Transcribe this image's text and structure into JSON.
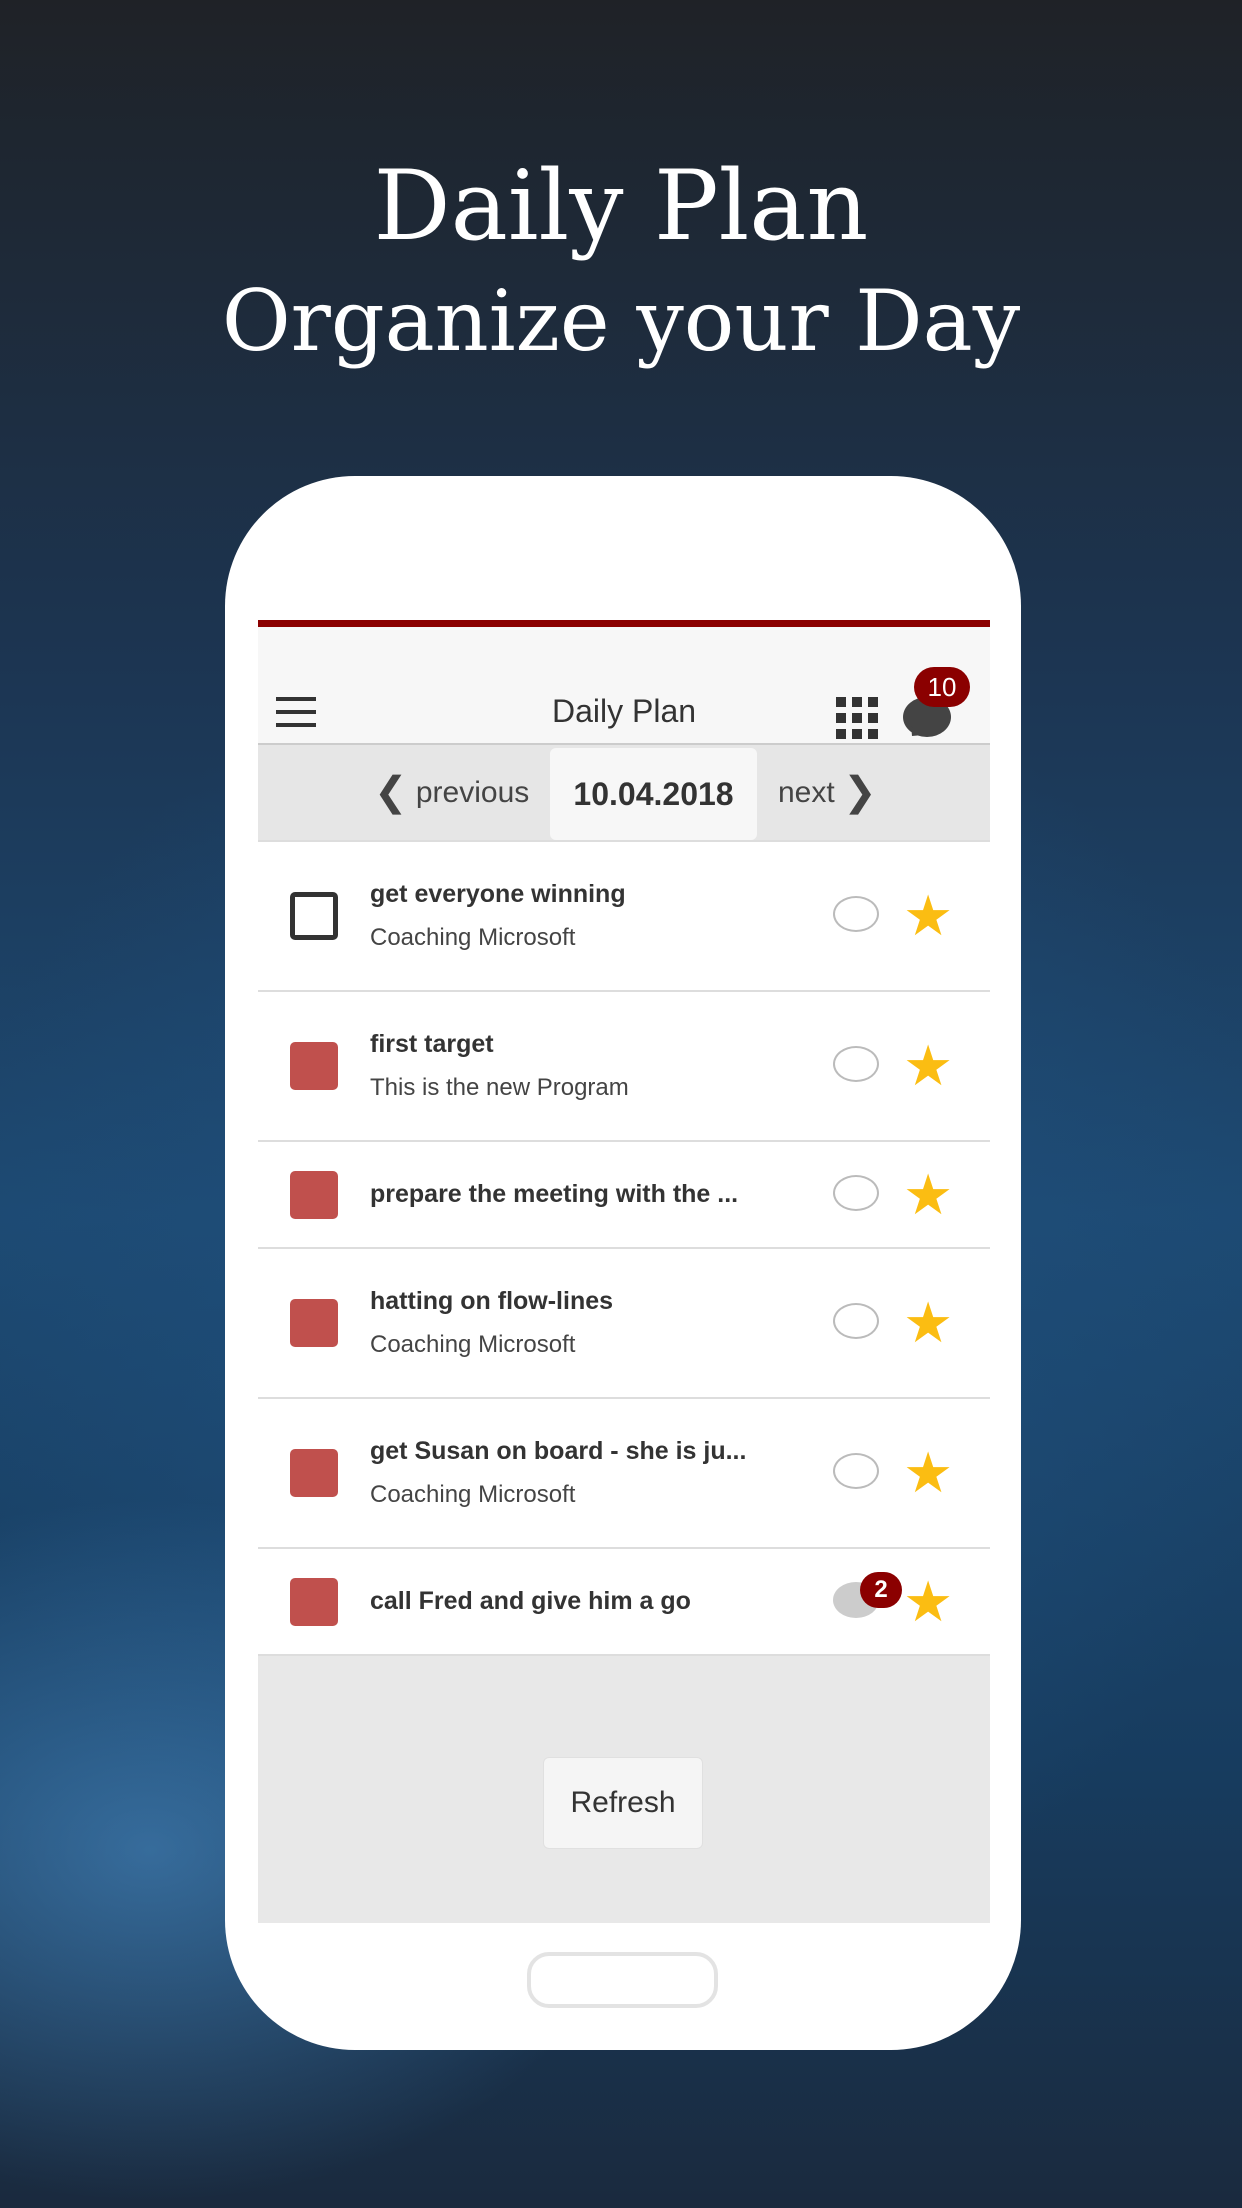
{
  "hero": {
    "title": "Daily Plan",
    "subtitle": "Organize your Day"
  },
  "header": {
    "title": "Daily Plan",
    "notification_count": "10"
  },
  "nav": {
    "previous": "previous",
    "date": "10.04.2018",
    "next": "next"
  },
  "tasks": [
    {
      "title": "get everyone winning",
      "subtitle": "Coaching Microsoft",
      "done": false,
      "starred": true
    },
    {
      "title": "first target",
      "subtitle": "This is the new Program",
      "done": true,
      "starred": true
    },
    {
      "title": "prepare the meeting with the ...",
      "done": true,
      "starred": true
    },
    {
      "title": "hatting on flow-lines",
      "subtitle": "Coaching Microsoft",
      "done": true,
      "starred": true
    },
    {
      "title": "get Susan on board - she is ju...",
      "subtitle": "Coaching Microsoft",
      "done": true,
      "starred": true
    },
    {
      "title": "call Fred and give him a go",
      "done": true,
      "starred": true,
      "comment_count": "2"
    }
  ],
  "refresh_label": "Refresh",
  "colors": {
    "accent": "#8b0000",
    "task_marker": "#c0504d",
    "star": "#fbbd12"
  }
}
